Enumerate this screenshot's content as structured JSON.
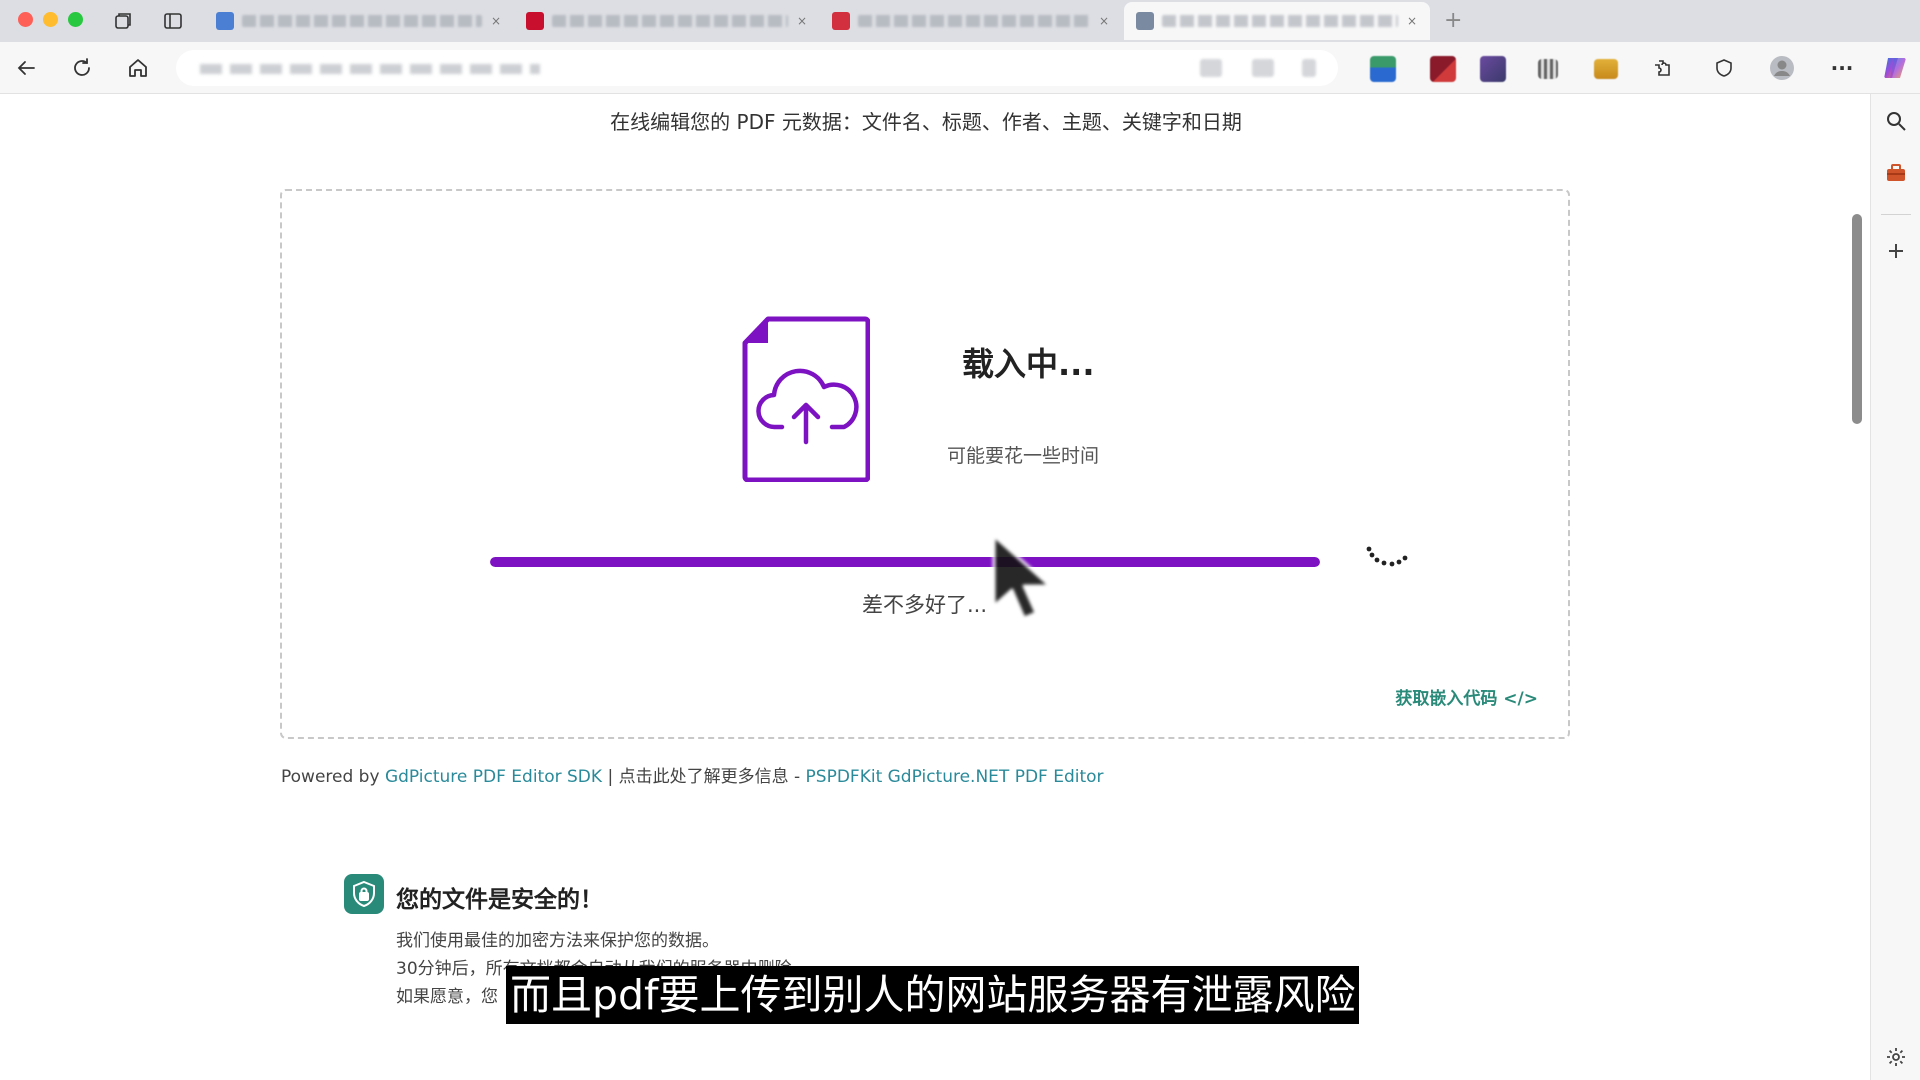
{
  "browser": {
    "tabs": [
      {
        "fav_color": "#4a7fd4"
      },
      {
        "fav_color": "#c8102e"
      },
      {
        "fav_color": "#d22f3f"
      },
      {
        "fav_color": "#7a8aa0",
        "active": true
      }
    ],
    "new_tab_label": "+",
    "more_label": "···"
  },
  "page": {
    "subtitle": "在线编辑您的 PDF 元数据：文件名、标题、作者、主题、关键字和日期",
    "loading": {
      "title": "载入中...",
      "subtitle": "可能要花一些时间",
      "status": "差不多好了...",
      "progress": 1.0
    },
    "embed_link": "获取嵌入代码 </>",
    "powered": {
      "prefix": "Powered by ",
      "link1": "GdPicture PDF Editor SDK",
      "middle": " | 点击此处了解更多信息 - ",
      "link2": "PSPDFKit GdPicture.NET PDF Editor"
    },
    "security": {
      "title": "您的文件是安全的！",
      "lines": [
        "我们使用最佳的加密方法来保护您的数据。",
        "30分钟后，所有文档都会自动从我们的服务器中删除。",
        "如果愿意，您"
      ]
    },
    "caption": "而且pdf要上传到别人的网站服务器有泄露风险"
  },
  "colors": {
    "accent": "#7c12c2",
    "link": "#2a8a9a",
    "shield": "#2a8a7a"
  },
  "icons": [
    "tab-overview-icon",
    "sidebar-toggle-icon",
    "back-icon",
    "reload-icon",
    "home-icon",
    "extensions-icon",
    "shield-icon",
    "profile-icon",
    "copilot-icon",
    "search-icon",
    "briefcase-icon",
    "plus-icon",
    "settings-icon",
    "file-upload-icon",
    "cloud-upload-icon",
    "spinner-icon",
    "mouse-cursor-icon"
  ]
}
